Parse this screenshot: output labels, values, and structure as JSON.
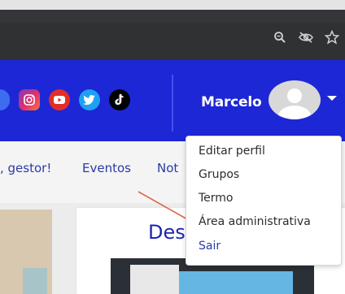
{
  "browser": {
    "icons": [
      "zoom-icon",
      "eye-off-icon",
      "star-icon"
    ]
  },
  "header": {
    "social_icons": [
      "instagram-icon",
      "youtube-icon",
      "twitter-icon",
      "tiktok-icon"
    ],
    "user_name": "Marcelo",
    "colors": {
      "header_bg": "#1d27d6",
      "instagram": "#d6249f",
      "youtube": "#e52d27",
      "twitter": "#1da1f2",
      "tiktok": "#000000"
    }
  },
  "nav": {
    "items": [
      ", gestor!",
      "Eventos",
      "Not"
    ]
  },
  "content": {
    "card_title": "Des"
  },
  "user_menu": {
    "items": [
      "Editar perfil",
      "Grupos",
      "Termo",
      "Área administrativa",
      "Sair"
    ]
  },
  "annotation": {
    "arrow_color": "#e0674a"
  }
}
